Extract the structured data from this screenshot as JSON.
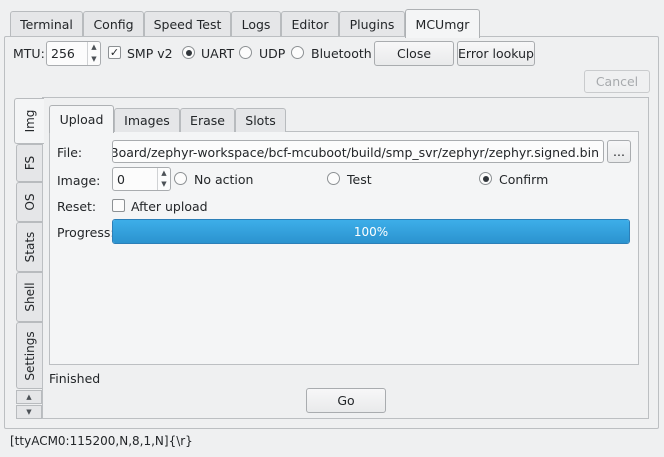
{
  "top_tabs": [
    {
      "label": "Terminal"
    },
    {
      "label": "Config"
    },
    {
      "label": "Speed Test"
    },
    {
      "label": "Logs"
    },
    {
      "label": "Editor"
    },
    {
      "label": "Plugins"
    },
    {
      "label": "MCUmgr"
    }
  ],
  "active_top_tab": "MCUmgr",
  "mtu": {
    "label": "MTU:",
    "value": "256"
  },
  "smp_v2": {
    "label": "SMP v2",
    "checked": true
  },
  "transport": [
    {
      "label": "UART",
      "checked": true
    },
    {
      "label": "UDP",
      "checked": false
    },
    {
      "label": "Bluetooth",
      "checked": false
    }
  ],
  "buttons": {
    "close": "Close",
    "error_lookup": "Error lookup",
    "cancel": "Cancel",
    "go": "Go",
    "browse": "..."
  },
  "side_tabs": [
    {
      "label": "Img"
    },
    {
      "label": "FS"
    },
    {
      "label": "OS"
    },
    {
      "label": "Stats"
    },
    {
      "label": "Shell"
    },
    {
      "label": "Settings"
    }
  ],
  "inner_tabs": [
    {
      "label": "Upload"
    },
    {
      "label": "Images"
    },
    {
      "label": "Erase"
    },
    {
      "label": "Slots"
    }
  ],
  "upload": {
    "file_label": "File:",
    "file_value": "/BeagleBoard/zephyr-workspace/bcf-mcuboot/build/smp_svr/zephyr/zephyr.signed.bin",
    "image_label": "Image:",
    "image_value": "0",
    "image_actions": [
      {
        "label": "No action",
        "checked": false
      },
      {
        "label": "Test",
        "checked": false
      },
      {
        "label": "Confirm",
        "checked": true
      }
    ],
    "reset_label": "Reset:",
    "after_upload_label": "After upload",
    "after_upload_checked": false,
    "progress_label": "Progress:",
    "progress_value": 100,
    "progress_text": "100%"
  },
  "status_text": "Finished",
  "status_bar": "[ttyACM0:115200,N,8,1,N]{\\r}",
  "colors": {
    "accent": "#3daee9",
    "window_bg": "#eff0f1"
  }
}
